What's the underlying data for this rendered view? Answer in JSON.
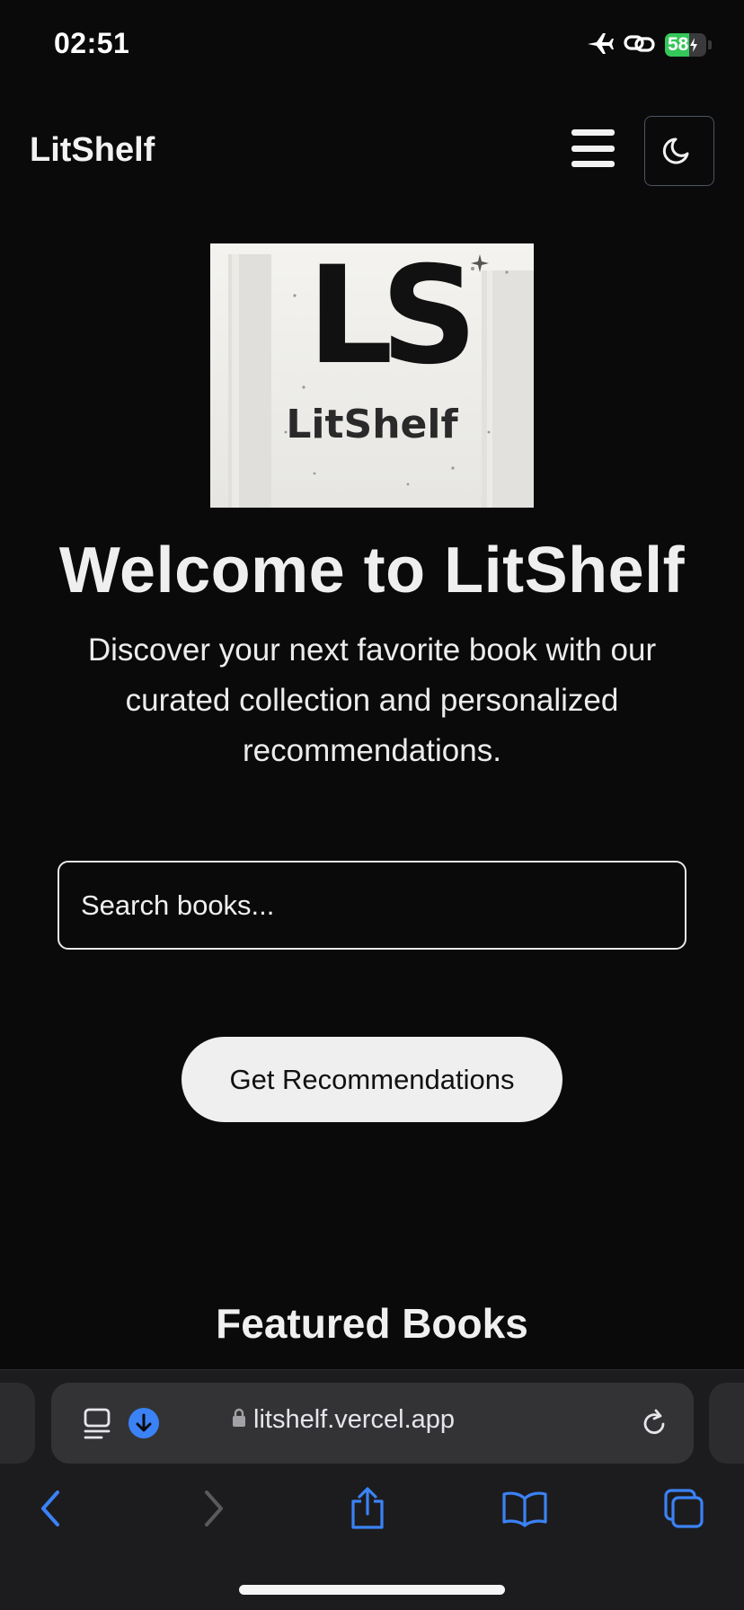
{
  "status_bar": {
    "time": "02:51",
    "battery_percent": "58",
    "battery_level": 0.58,
    "icons": [
      "airplane-icon",
      "link-icon",
      "battery-icon"
    ]
  },
  "nav": {
    "brand": "LitShelf",
    "menu_icon": "hamburger-menu-icon",
    "theme_icon": "moon-icon"
  },
  "hero": {
    "logo_monogram": "LS",
    "logo_wordmark": "LitShelf",
    "title": "Welcome to LitShelf",
    "subtitle": "Discover your next favorite book with our curated collection and personalized recommendations."
  },
  "search": {
    "placeholder": "Search books..."
  },
  "cta": {
    "label": "Get Recommendations"
  },
  "featured": {
    "title": "Featured Books"
  },
  "browser": {
    "url": "litshelf.vercel.app",
    "colors": {
      "accent": "#3b82f6",
      "toolbar_bg": "#1c1c1e",
      "address_bg": "#333336"
    },
    "icons": [
      "reader-icon",
      "download-icon",
      "lock-icon",
      "reload-icon",
      "back-icon",
      "forward-icon",
      "share-icon",
      "bookmarks-icon",
      "tabs-icon"
    ]
  }
}
